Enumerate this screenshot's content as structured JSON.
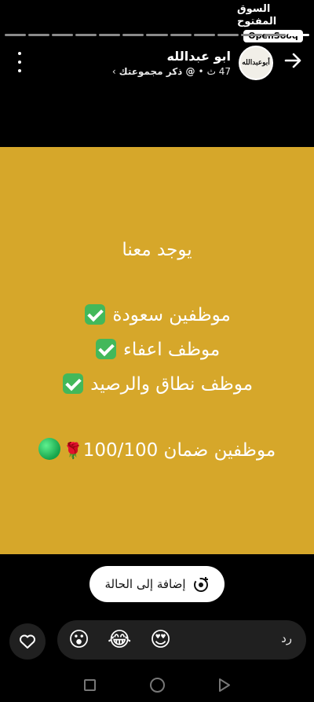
{
  "watermark": {
    "arabic": "السوق المفتوح",
    "english": "OpenSooq"
  },
  "progress": {
    "total": 13,
    "current": 1
  },
  "header": {
    "name": "ابو عبدالله",
    "time": "47 ث",
    "separator": "•",
    "mention": "@ ذكر مجموعتك",
    "chevron": "›",
    "avatar_text": "أبوعبدالله"
  },
  "status": {
    "line1": "يوجد معنا",
    "line2": "موظفين سعودة",
    "line3": "موظف اعفاء",
    "line4": "موظف نطاق والرصيد",
    "line5": "موظفين ضمان 100/100",
    "background_color": "#d6a72a"
  },
  "actions": {
    "add_to_status": "إضافة إلى الحالة"
  },
  "reply": {
    "label": "رد",
    "emojis": [
      "😍",
      "😂",
      "😮"
    ]
  }
}
